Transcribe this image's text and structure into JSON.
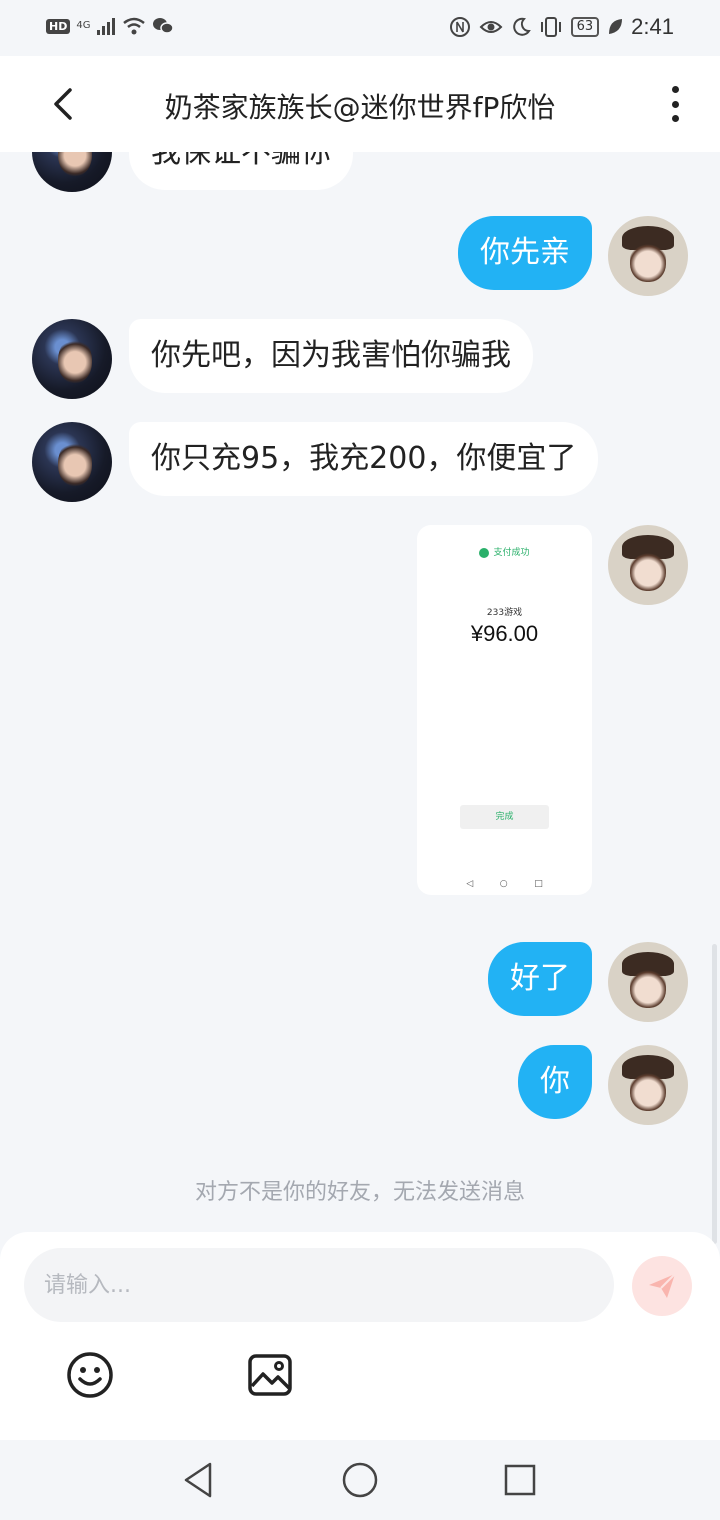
{
  "status_bar": {
    "hd": "HD",
    "network": "4G",
    "battery": "63",
    "time": "2:41"
  },
  "header": {
    "title": "奶茶家族族长@迷你世界fP欣怡"
  },
  "messages": [
    {
      "side": "in",
      "text": "我保证不骗你"
    },
    {
      "side": "out",
      "text": "你先亲"
    },
    {
      "side": "in",
      "text": "你先吧，因为我害怕你骗我"
    },
    {
      "side": "in",
      "text": "你只充95，我充200，你便宜了"
    },
    {
      "side": "out",
      "type": "image"
    },
    {
      "side": "out",
      "text": "好了"
    },
    {
      "side": "out",
      "text": "你"
    }
  ],
  "payment_screenshot": {
    "status": "支付成功",
    "merchant": "233游戏",
    "amount": "¥96.00",
    "done_button": "完成"
  },
  "notice": "对方不是你的好友，无法发送消息",
  "composer": {
    "placeholder": "请输入..."
  },
  "icons": {
    "back": "back-arrow-icon",
    "more": "more-vertical-icon",
    "send": "send-icon",
    "emoji": "emoji-icon",
    "image": "image-icon"
  },
  "colors": {
    "outgoing_bubble": "#22b2f4",
    "incoming_bubble": "#ffffff",
    "background": "#f4f6f9",
    "send_button": "#fde3e1"
  }
}
